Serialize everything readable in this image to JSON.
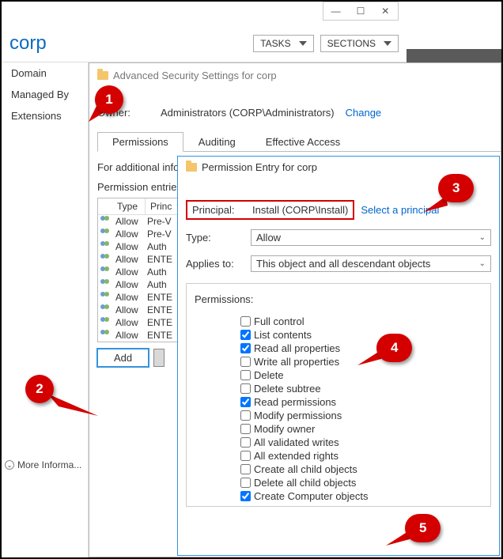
{
  "window": {
    "min": "—",
    "max": "☐",
    "close": "✕"
  },
  "header": {
    "title": "corp",
    "tasks": "TASKS",
    "sections": "SECTIONS"
  },
  "sidebar": {
    "items": [
      "Domain",
      "Managed By",
      "Extensions"
    ],
    "more": "More Informa..."
  },
  "adv": {
    "title": "Advanced Security Settings for corp",
    "owner_label": "Owner:",
    "owner_value": "Administrators (CORP\\Administrators)",
    "owner_change": "Change",
    "tabs": [
      "Permissions",
      "Auditing",
      "Effective Access"
    ],
    "info": "For additional infor",
    "entries_label": "Permission entries:",
    "cols": {
      "type": "Type",
      "princ": "Princ"
    },
    "rows": [
      {
        "type": "Allow",
        "princ": "Pre-V"
      },
      {
        "type": "Allow",
        "princ": "Pre-V"
      },
      {
        "type": "Allow",
        "princ": "Auth"
      },
      {
        "type": "Allow",
        "princ": "ENTE"
      },
      {
        "type": "Allow",
        "princ": "Auth"
      },
      {
        "type": "Allow",
        "princ": "Auth"
      },
      {
        "type": "Allow",
        "princ": "ENTE"
      },
      {
        "type": "Allow",
        "princ": "ENTE"
      },
      {
        "type": "Allow",
        "princ": "ENTE"
      },
      {
        "type": "Allow",
        "princ": "ENTE"
      }
    ],
    "add_btn": "Add"
  },
  "perm": {
    "title": "Permission Entry for corp",
    "principal_label": "Principal:",
    "principal_value": "Install (CORP\\Install)",
    "select_principal": "Select a principal",
    "type_label": "Type:",
    "type_value": "Allow",
    "applies_label": "Applies to:",
    "applies_value": "This object and all descendant objects",
    "perms_label": "Permissions:",
    "checks": [
      {
        "label": "Full control",
        "checked": false
      },
      {
        "label": "List contents",
        "checked": true
      },
      {
        "label": "Read all properties",
        "checked": true
      },
      {
        "label": "Write all properties",
        "checked": false
      },
      {
        "label": "Delete",
        "checked": false
      },
      {
        "label": "Delete subtree",
        "checked": false
      },
      {
        "label": "Read permissions",
        "checked": true
      },
      {
        "label": "Modify permissions",
        "checked": false
      },
      {
        "label": "Modify owner",
        "checked": false
      },
      {
        "label": "All validated writes",
        "checked": false
      },
      {
        "label": "All extended rights",
        "checked": false
      },
      {
        "label": "Create all child objects",
        "checked": false
      },
      {
        "label": "Delete all child objects",
        "checked": false
      },
      {
        "label": "Create Computer objects",
        "checked": true
      }
    ]
  },
  "callouts": {
    "c1": "1",
    "c2": "2",
    "c3": "3",
    "c4": "4",
    "c5": "5"
  }
}
